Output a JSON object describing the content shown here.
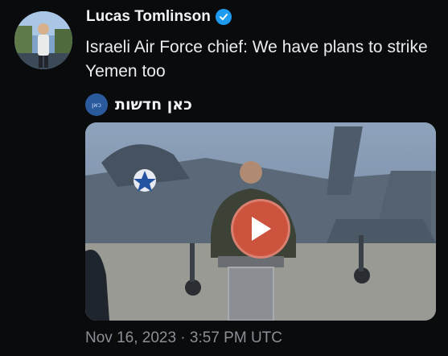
{
  "author": {
    "name": "Lucas Tomlinson",
    "verified": true
  },
  "tweet": {
    "text": "Israeli Air Force chief: We have plans to strike Yemen too"
  },
  "source": {
    "name": "כאן חדשות",
    "logo_icon": "kan-news-logo"
  },
  "media": {
    "type": "video",
    "play_icon": "play-icon",
    "play_color": "#e05641"
  },
  "meta": {
    "timestamp": "Nov 16, 2023 · 3:57 PM UTC"
  },
  "colors": {
    "background": "#0a0b0d",
    "text": "#e7e9ea",
    "muted": "#8b8f96",
    "verified": "#1d9bf0"
  }
}
